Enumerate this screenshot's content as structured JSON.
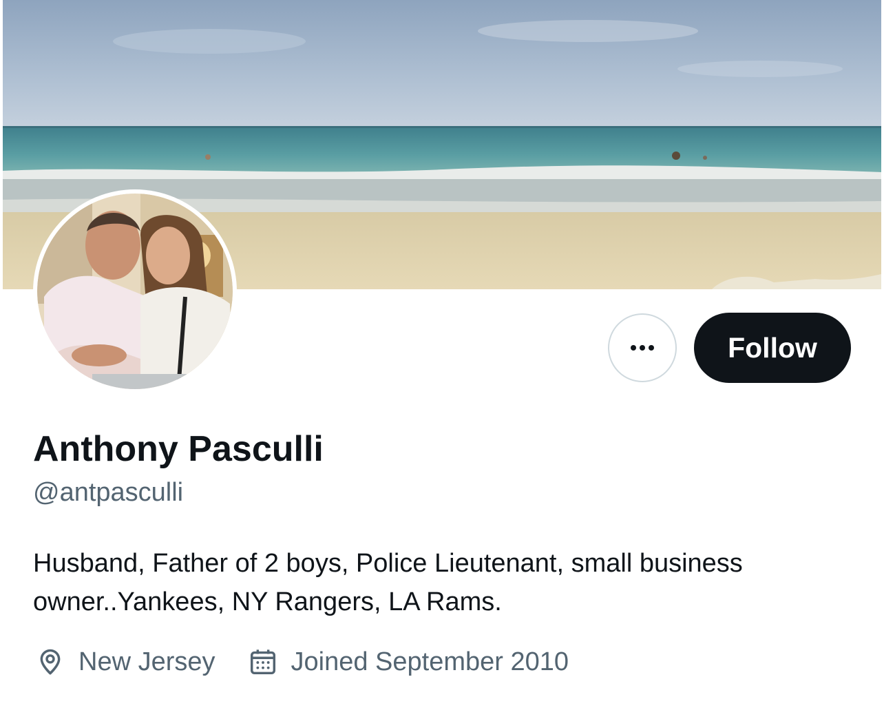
{
  "header": {
    "banner_icon": "beach-banner-image"
  },
  "profile": {
    "display_name": "Anthony Pasculli",
    "handle": "@antpasculli",
    "bio": "Husband, Father of 2 boys, Police Lieutenant, small business owner..Yankees, NY Rangers, LA Rams.",
    "location": "New Jersey",
    "joined": "Joined September 2010"
  },
  "actions": {
    "more_icon": "more-horizontal-icon",
    "follow_label": "Follow"
  },
  "meta_icons": {
    "location": "map-pin-icon",
    "joined": "calendar-icon"
  },
  "colors": {
    "primary_text": "#0f1419",
    "secondary_text": "#536471",
    "button_dark": "#0f1419",
    "button_border": "#cfd9de",
    "background": "#ffffff"
  }
}
